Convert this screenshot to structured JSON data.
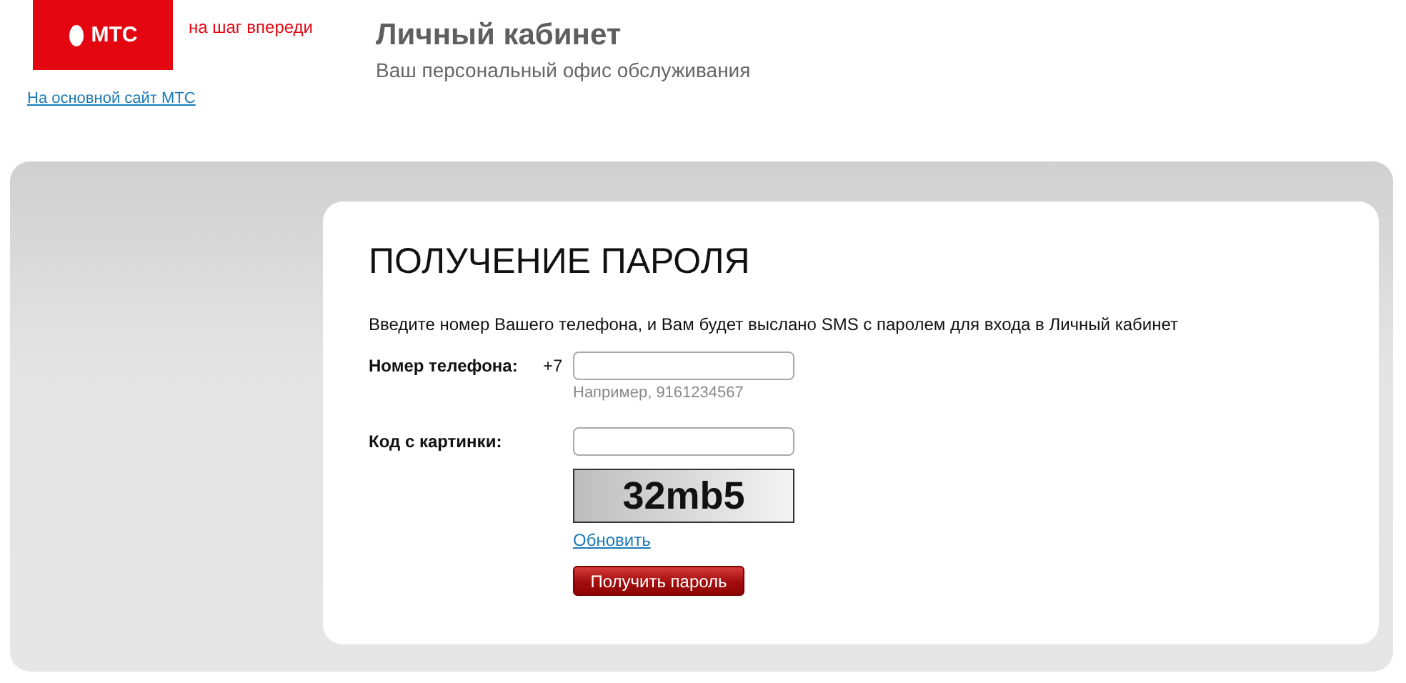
{
  "header": {
    "logo_text": "МТС",
    "tagline": "на шаг впереди",
    "main_site_link": "На основной сайт МТС",
    "title": "Личный кабинет",
    "subtitle": "Ваш персональный офис обслуживания"
  },
  "form": {
    "heading": "ПОЛУЧЕНИЕ ПАРОЛЯ",
    "intro": "Введите номер Вашего телефона, и Вам будет выслано SMS с паролем для входа в Личный кабинет",
    "phone": {
      "label": "Номер телефона:",
      "prefix": "+7",
      "hint": "Например, 9161234567"
    },
    "captcha": {
      "label": "Код с картинки:",
      "code": "32mb5",
      "refresh_link": "Обновить"
    },
    "submit_button": "Получить пароль"
  }
}
